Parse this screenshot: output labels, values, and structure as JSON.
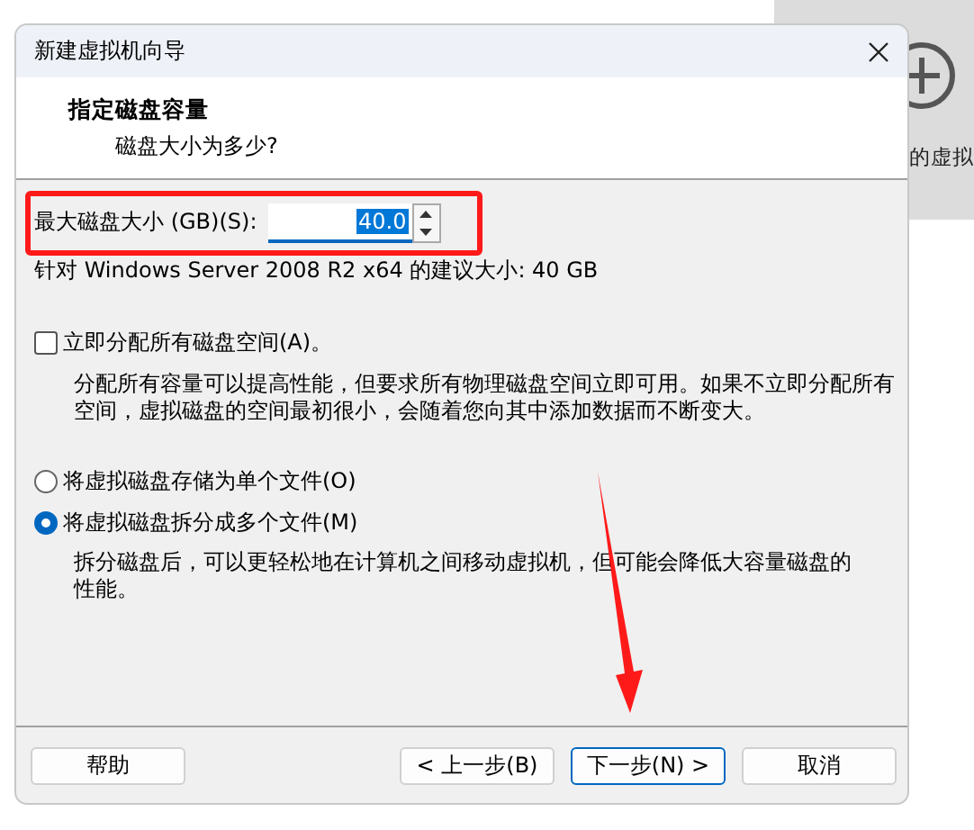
{
  "window": {
    "title": "新建虚拟机向导"
  },
  "header": {
    "title": "指定磁盘容量",
    "subtitle": "磁盘大小为多少?"
  },
  "disk_size": {
    "label": "最大磁盘大小 (GB)(S):",
    "value": "40.0",
    "focused": true
  },
  "recommendation": "针对 Windows Server 2008 R2 x64 的建议大小: 40 GB",
  "allocate_now": {
    "label": "立即分配所有磁盘空间(A)。",
    "checked": false,
    "description": "分配所有容量可以提高性能，但要求所有物理磁盘空间立即可用。如果不立即分配所有空间，虚拟磁盘的空间最初很小，会随着您向其中添加数据而不断变大。"
  },
  "storage_options": [
    {
      "label": "将虚拟磁盘存储为单个文件(O)",
      "selected": false
    },
    {
      "label": "将虚拟磁盘拆分成多个文件(M)",
      "selected": true,
      "description": "拆分磁盘后，可以更轻松地在计算机之间移动虚拟机，但可能会降低大容量磁盘的性能。"
    }
  ],
  "buttons": [
    {
      "label": "帮助",
      "kind": "help",
      "default": false
    },
    {
      "label": "< 上一步(B)",
      "kind": "nav",
      "default": false
    },
    {
      "label": "下一步(N) >",
      "kind": "nav",
      "default": true
    },
    {
      "label": "取消",
      "kind": "nav",
      "default": false
    }
  ],
  "background": {
    "text": "的虚拟"
  }
}
